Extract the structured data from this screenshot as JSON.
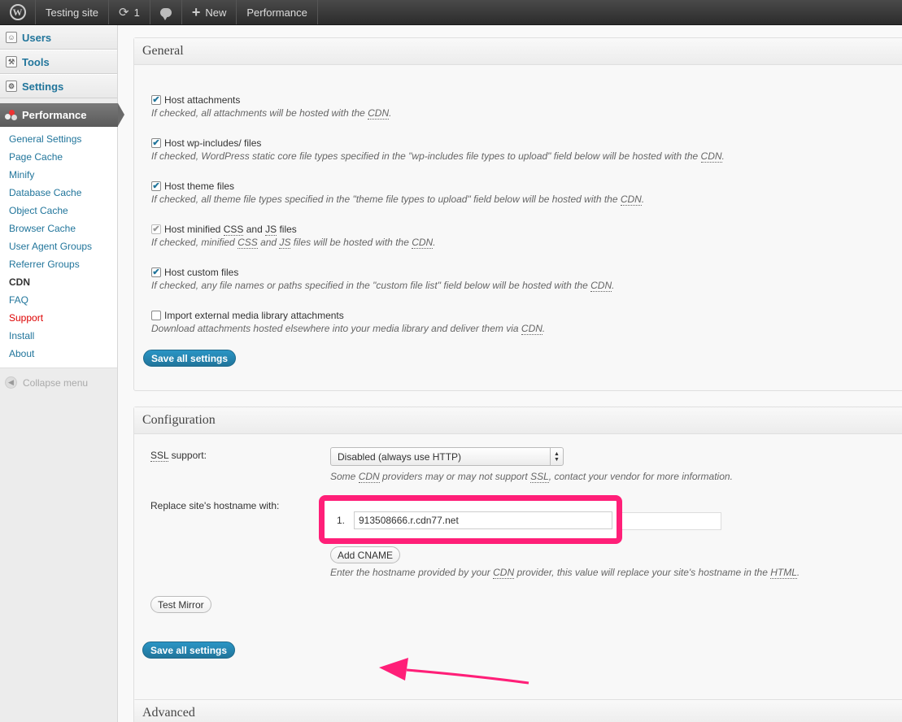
{
  "admin_bar": {
    "site_name": "Testing site",
    "updates_count": "1",
    "new_label": "New",
    "performance_label": "Performance"
  },
  "sidebar": {
    "top_items": [
      {
        "label": "Users",
        "icon": "users-icon"
      },
      {
        "label": "Tools",
        "icon": "tools-icon"
      },
      {
        "label": "Settings",
        "icon": "settings-icon"
      }
    ],
    "current_menu": "Performance",
    "submenu": [
      "General Settings",
      "Page Cache",
      "Minify",
      "Database Cache",
      "Object Cache",
      "Browser Cache",
      "User Agent Groups",
      "Referrer Groups",
      "CDN",
      "FAQ",
      "Support",
      "Install",
      "About"
    ],
    "current_submenu": "CDN",
    "collapse_label": "Collapse menu"
  },
  "general": {
    "title": "General",
    "options": [
      {
        "label": "Host attachments",
        "checked": true,
        "desc_pre": "If checked, all attachments will be hosted with the ",
        "desc_post": "."
      },
      {
        "label": "Host wp-includes/ files",
        "checked": true,
        "desc_pre": "If checked, WordPress static core file types specified in the \"wp-includes file types to upload\" field below will be hosted with the ",
        "desc_post": "."
      },
      {
        "label": "Host theme files",
        "checked": true,
        "desc_pre": "If checked, all theme file types specified in the \"theme file types to upload\" field below will be hosted with the ",
        "desc_post": "."
      },
      {
        "label_pre": "Host minified ",
        "label_css": "CSS",
        "label_mid": " and ",
        "label_js": "JS",
        "label_post": " files",
        "checked": true,
        "disabled": true,
        "desc_pre": "If checked, minified ",
        "desc_css": "CSS",
        "desc_mid": " and ",
        "desc_js": "JS",
        "desc_mid2": " files will be hosted with the ",
        "desc_post": "."
      },
      {
        "label": "Host custom files",
        "checked": true,
        "desc_pre": "If checked, any file names or paths specified in the \"custom file list\" field below will be hosted with the ",
        "desc_post": "."
      },
      {
        "label": "Import external media library attachments",
        "checked": false,
        "desc_pre": "Download attachments hosted elsewhere into your media library and deliver them via ",
        "desc_post": "."
      }
    ],
    "abbr_cdn": "CDN",
    "save_label": "Save all settings"
  },
  "configuration": {
    "title": "Configuration",
    "ssl_abbr": "SSL",
    "ssl_label_post": " support:",
    "ssl_value": "Disabled (always use HTTP)",
    "ssl_desc_pre": "Some ",
    "ssl_desc_cdn": "CDN",
    "ssl_desc_mid": " providers may or may not support ",
    "ssl_desc_ssl": "SSL",
    "ssl_desc_post": ", contact your vendor for more information.",
    "hostname_label": "Replace site's hostname with:",
    "cname_number": "1.",
    "cname_value": "913508666.r.cdn77.net",
    "add_cname_label": "Add CNAME",
    "hostname_desc_pre": "Enter the hostname provided by your ",
    "hostname_desc_cdn": "CDN",
    "hostname_desc_mid": " provider, this value will replace your site's hostname in the ",
    "hostname_desc_html": "HTML",
    "hostname_desc_post": ".",
    "test_mirror_label": "Test Mirror",
    "save_label": "Save all settings",
    "highlight_color": "#ff1f78"
  },
  "advanced": {
    "title": "Advanced"
  }
}
